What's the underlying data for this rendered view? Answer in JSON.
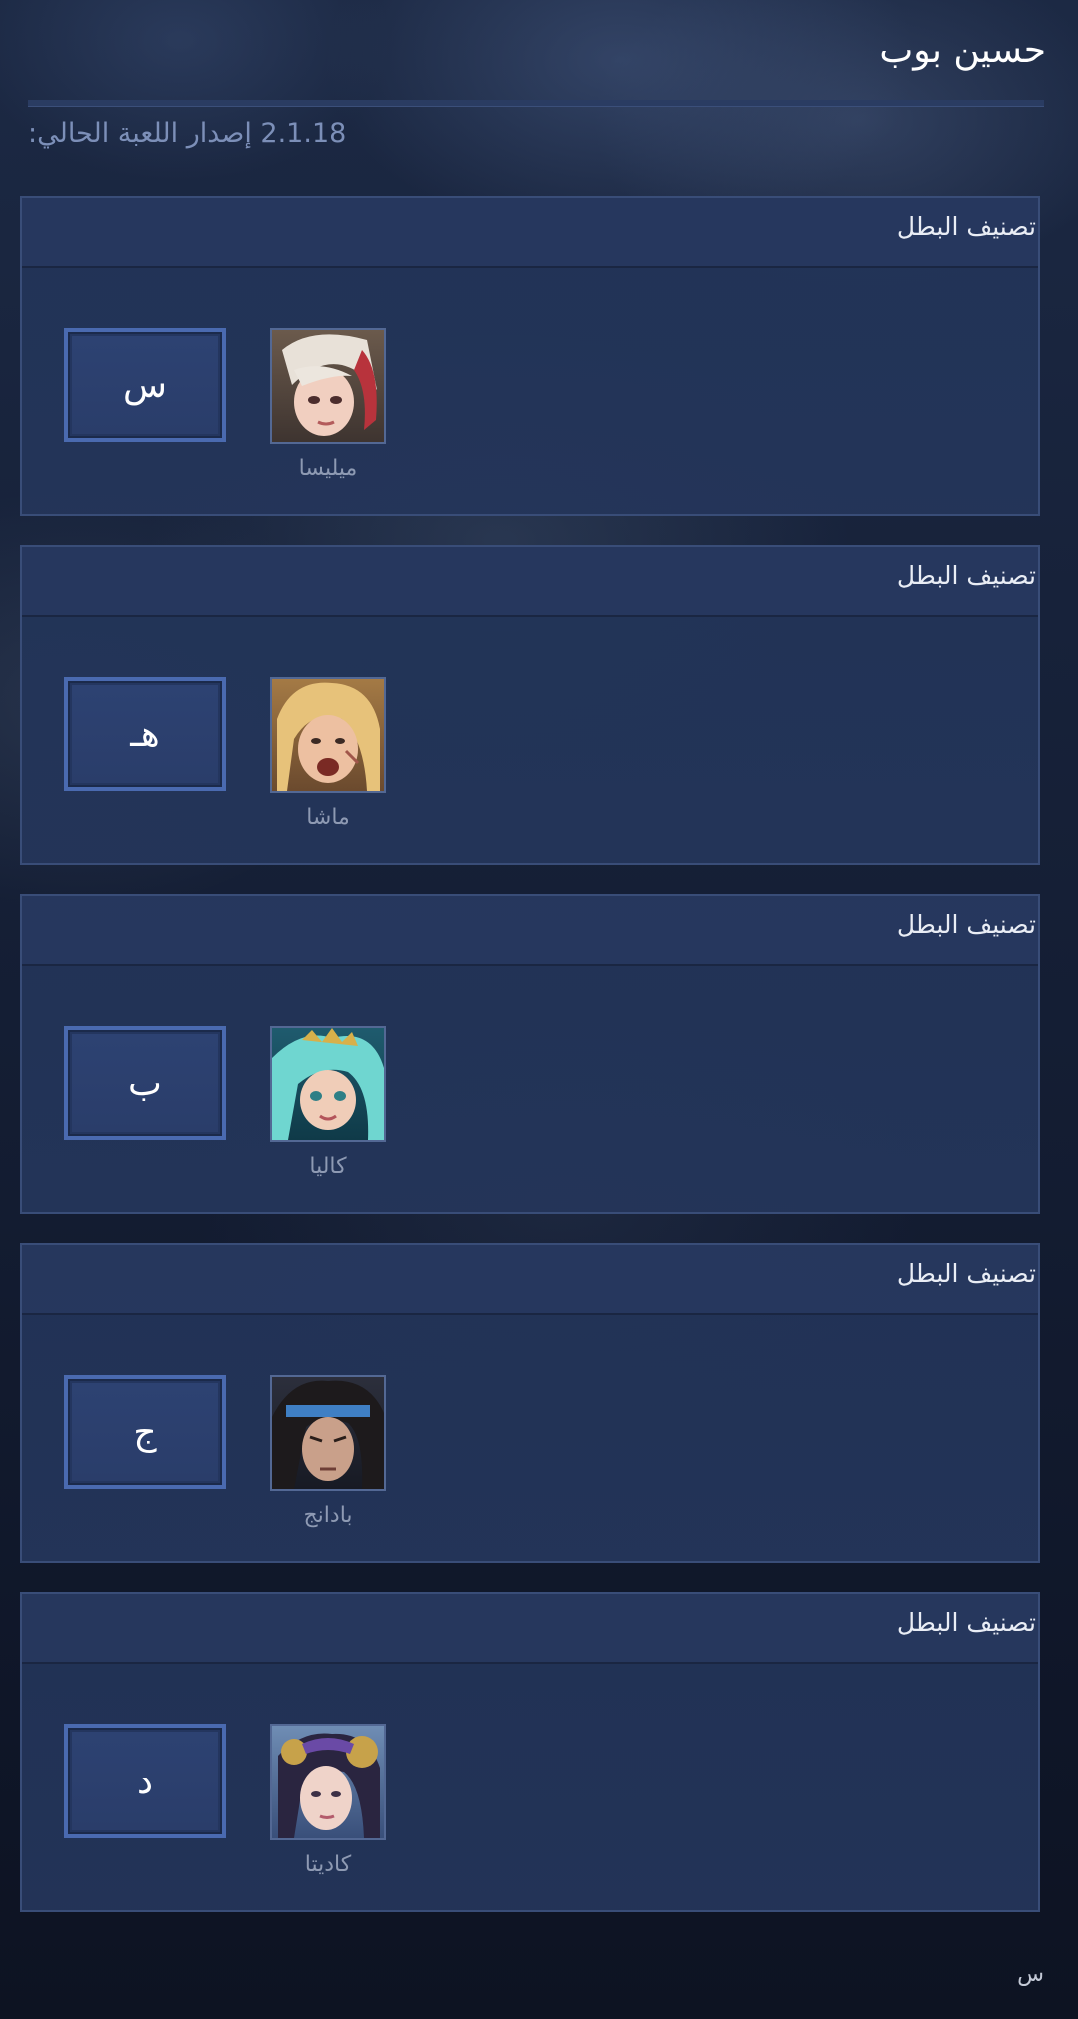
{
  "app": {
    "title": "حسين بوب",
    "version_text": "2.1.18 إصدار اللعبة الحالي:"
  },
  "sections": [
    {
      "header": "تصنيف البطل",
      "grade": "س",
      "hero": "ميليسا",
      "portrait_icon": "melissa-portrait"
    },
    {
      "header": "تصنيف البطل",
      "grade": "هـ",
      "hero": "ماشا",
      "portrait_icon": "masha-portrait"
    },
    {
      "header": "تصنيف البطل",
      "grade": "ب",
      "hero": "كاليا",
      "portrait_icon": "kalea-portrait"
    },
    {
      "header": "تصنيف البطل",
      "grade": "ج",
      "hero": "بادانج",
      "portrait_icon": "badang-portrait"
    },
    {
      "header": "تصنيف البطل",
      "grade": "د",
      "hero": "كاديتا",
      "portrait_icon": "kadita-portrait"
    }
  ],
  "footer": {
    "letter": "س"
  },
  "colors": {
    "background": "#101728",
    "panel": "#24355a",
    "grade_border": "#4a6ab0",
    "muted_text": "#8e9ab3"
  }
}
